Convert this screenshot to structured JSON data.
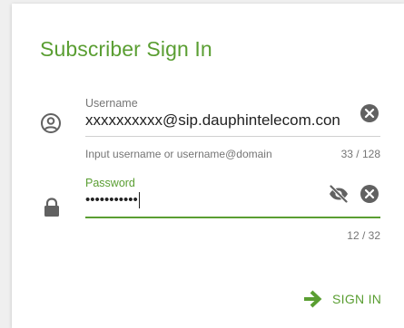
{
  "dialog": {
    "title": "Subscriber Sign In"
  },
  "username": {
    "icon": "account-circle-icon",
    "label": "Username",
    "value": "xxxxxxxxxx@sip.dauphintelecom.con",
    "hint": "Input username or username@domain",
    "counter": "33 / 128"
  },
  "password": {
    "icon": "lock-icon",
    "label": "Password",
    "value": "•••••••••••",
    "counter": "12 / 32"
  },
  "actions": {
    "sign_in_label": "SIGN IN"
  },
  "colors": {
    "accent": "#5a9e32",
    "icon_gray": "#616161",
    "text": "#222222",
    "muted": "#757575",
    "background": "#efefef",
    "card": "#ffffff"
  }
}
